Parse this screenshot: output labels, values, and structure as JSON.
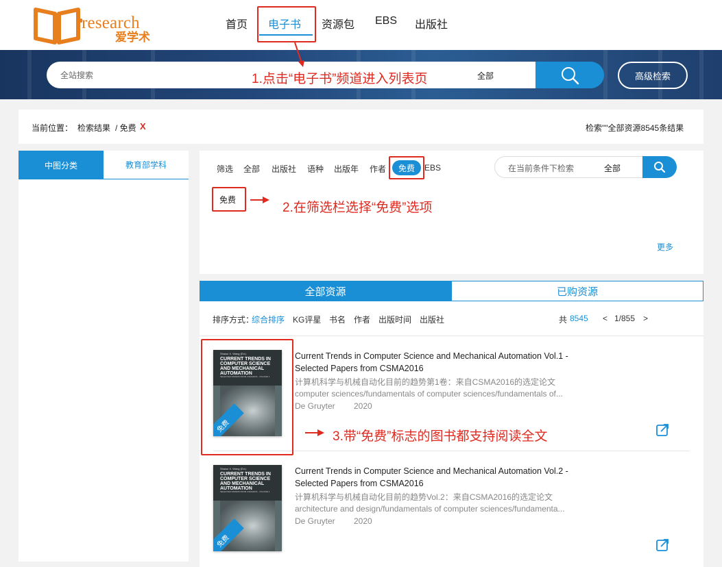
{
  "logo": {
    "word": "research",
    "cn": "爱学术"
  },
  "nav": {
    "items": [
      "首页",
      "电子书",
      "资源包",
      "EBS",
      "出版社"
    ]
  },
  "search": {
    "placeholder": "全站搜索",
    "scope": "全部",
    "advanced": "高级检索"
  },
  "breadcrumb": {
    "label": "当前位置：",
    "path": "检索结果",
    "filter": "/ 免费",
    "remove": "X",
    "summary": "检索\"\"全部资源8545条结果"
  },
  "sidebar": {
    "tabs": [
      "中图分类",
      "教育部学科"
    ]
  },
  "filter": {
    "items": [
      "筛选",
      "全部",
      "出版社",
      "语种",
      "出版年",
      "作者",
      "免费",
      "EBS"
    ],
    "search_placeholder": "在当前条件下检索",
    "search_scope": "全部",
    "selected": "免费",
    "more": "更多"
  },
  "result_tabs": [
    "全部资源",
    "已购资源"
  ],
  "sort": {
    "label": "排序方式：",
    "options": [
      "综合排序",
      "KG评星",
      "书名",
      "作者",
      "出版时间",
      "出版社"
    ],
    "total_prefix": "共",
    "total": "8545",
    "page_prev": "<",
    "page": "1/855",
    "page_next": ">"
  },
  "books": [
    {
      "title": "Current Trends in Computer Science and Mechanical Automation Vol.1 - Selected Papers from CSMA2016",
      "title_cn": "计算机科学与机械自动化目前的趋势第1卷：来自CSMA2016的选定论文",
      "subjects": "computer sciences/fundamentals of computer sciences/fundamentals of...",
      "publisher": "De Gruyter",
      "year": "2020",
      "badge": "免费",
      "cover": {
        "author": "Shawn X. Wang (Ed.)",
        "title": "CURRENT TRENDS IN COMPUTER SCIENCE AND MECHANICAL AUTOMATION",
        "subtitle": "SELECTED PAPERS FROM CSMA2016 - VOLUME 1"
      }
    },
    {
      "title": "Current Trends in Computer Science and Mechanical Automation Vol.2 - Selected Papers from CSMA2016",
      "title_cn": "计算机科学与机械自动化目前的趋势Vol.2：来自CSMA2016的选定论文",
      "subjects": "architecture and design/fundamentals of computer sciences/fundamenta...",
      "publisher": "De Gruyter",
      "year": "2020",
      "badge": "免费",
      "cover": {
        "author": "Shawn X. Wang (Ed.)",
        "title": "CURRENT TRENDS IN COMPUTER SCIENCE AND MECHANICAL AUTOMATION",
        "subtitle": "SELECTED PAPERS FROM CSMA2016 - VOLUME 2"
      }
    }
  ],
  "annotations": {
    "step1": "1.点击“电子书”频道进入列表页",
    "step2": "2.在筛选栏选择“免费”选项",
    "step3": "3.带“免费”标志的图书都支持阅读全文"
  },
  "colors": {
    "accent": "#1a8fd6",
    "logo": "#e87f1e",
    "annotation": "#e0291f"
  }
}
